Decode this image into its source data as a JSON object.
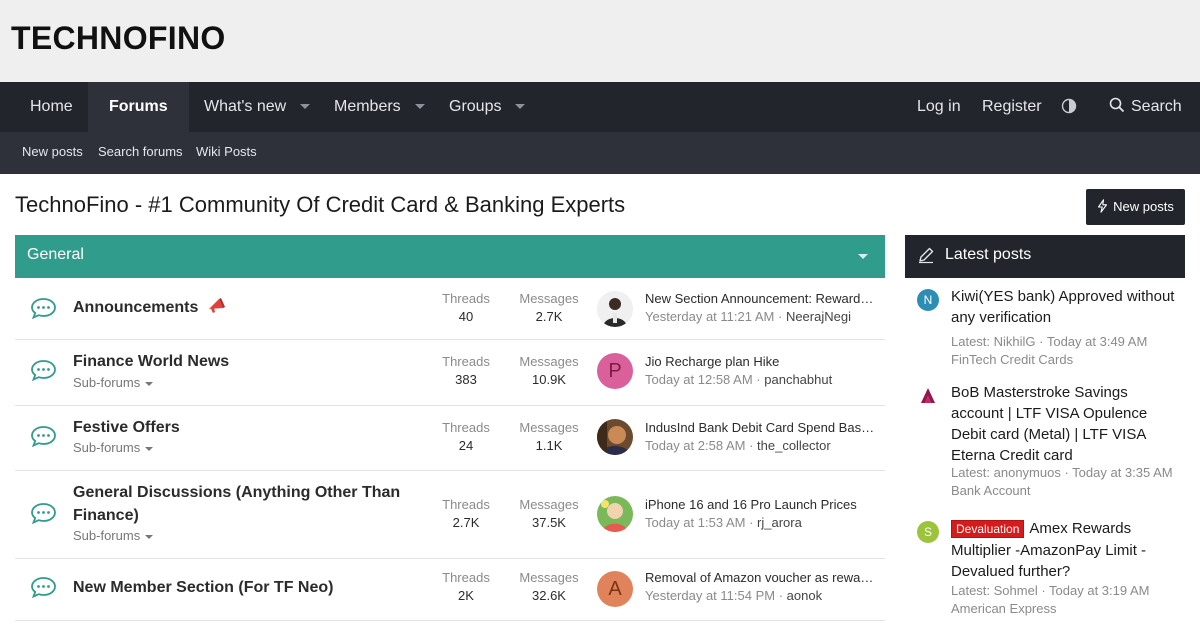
{
  "site": {
    "logo": "TECHNOFINO"
  },
  "nav": {
    "items": [
      {
        "label": "Home"
      },
      {
        "label": "Forums"
      },
      {
        "label": "What's new"
      },
      {
        "label": "Members"
      },
      {
        "label": "Groups"
      }
    ],
    "login": "Log in",
    "register": "Register",
    "search": "Search",
    "icons": {
      "theme": "half-moon-icon",
      "search": "search-icon"
    }
  },
  "subnav": [
    "New posts",
    "Search forums",
    "Wiki Posts"
  ],
  "page": {
    "title": "TechnoFino - #1 Community Of Credit Card & Banking Experts",
    "new_posts_button": "New posts"
  },
  "forum_block": {
    "title": "General",
    "stat_labels": {
      "threads": "Threads",
      "messages": "Messages"
    },
    "subforums_label": "Sub-forums",
    "rows": [
      {
        "title": "Announcements",
        "threads": "40",
        "messages": "2.7K",
        "last_title": "New Section Announcement: Reward …",
        "last_time": "Yesterday at 11:21 AM",
        "last_user": "NeerajNegi",
        "avatar_letter": ""
      },
      {
        "title": "Finance World News",
        "threads": "383",
        "messages": "10.9K",
        "last_title": "Jio Recharge plan Hike",
        "last_time": "Today at 12:58 AM",
        "last_user": "panchabhut",
        "avatar_letter": "P"
      },
      {
        "title": "Festive Offers",
        "threads": "24",
        "messages": "1.1K",
        "last_title": "IndusInd Bank Debit Card Spend Base…",
        "last_time": "Today at 2:58 AM",
        "last_user": "the_collector",
        "avatar_letter": ""
      },
      {
        "title": "General Discussions (Anything Other Than Finance)",
        "threads": "2.7K",
        "messages": "37.5K",
        "last_title": "iPhone 16 and 16 Pro Launch Prices",
        "last_time": "Today at 1:53 AM",
        "last_user": "rj_arora",
        "avatar_letter": ""
      },
      {
        "title": "New Member Section (For TF Neo)",
        "threads": "2K",
        "messages": "32.6K",
        "last_title": "Removal of Amazon voucher as rewar…",
        "last_time": "Yesterday at 11:54 PM",
        "last_user": "aonok",
        "avatar_letter": "A"
      }
    ]
  },
  "sidebar": {
    "title": "Latest posts",
    "posts": [
      {
        "avatar_letter": "N",
        "prefix": "",
        "title": "Kiwi(YES bank) Approved without any verification",
        "meta": "Latest: NikhilG · Today at 3:49 AM",
        "forum": "FinTech Credit Cards"
      },
      {
        "avatar_letter": "",
        "prefix": "",
        "title": "BoB Masterstroke Savings account | LTF VISA Opulence Debit card (Metal) | LTF VISA Eterna Credit card",
        "meta": "Latest: anonymuos · Today at 3:35 AM",
        "forum": "Bank Account"
      },
      {
        "avatar_letter": "S",
        "prefix": "Devaluation",
        "title": "Amex Rewards Multiplier -AmazonPay Limit - Devalued further?",
        "meta": "Latest: Sohmel · Today at 3:19 AM",
        "forum": "American Express"
      }
    ]
  },
  "colors": {
    "nav_bg": "#22252c",
    "subnav_bg": "#2e313a",
    "block_head": "#2f9c8c",
    "badge": "#d41c1c"
  }
}
